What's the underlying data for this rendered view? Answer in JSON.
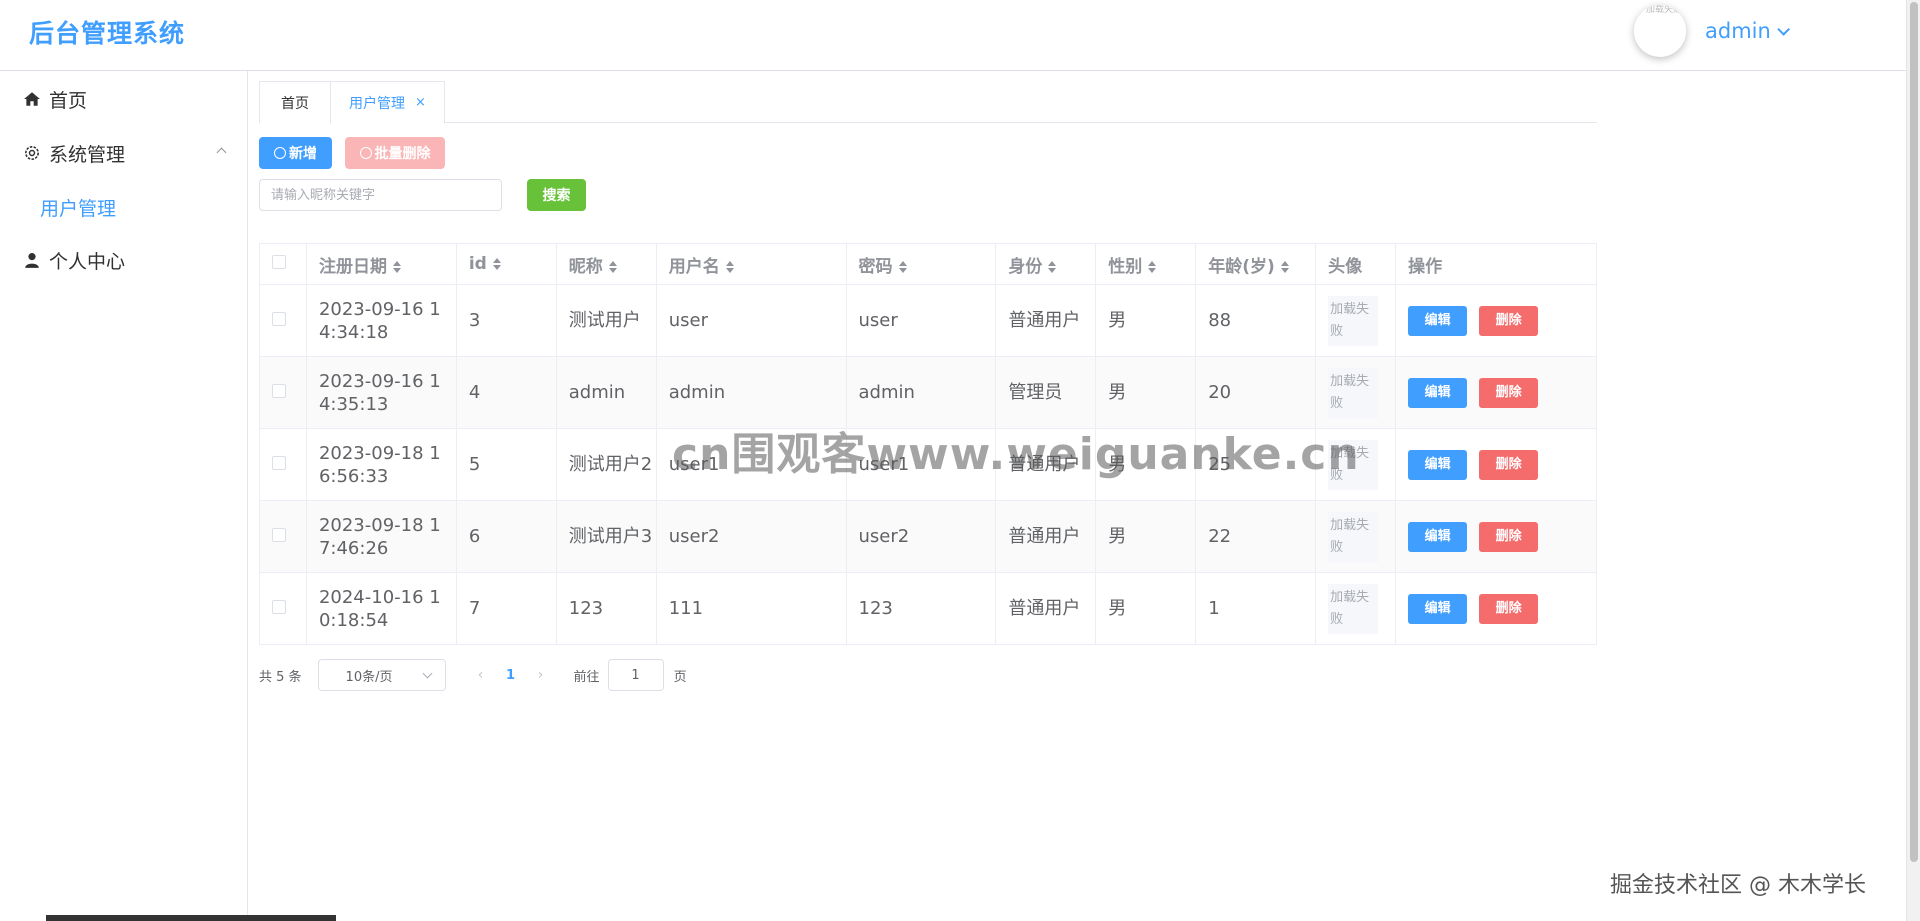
{
  "header": {
    "title": "后台管理系统",
    "avatar_text": "加载失败",
    "user_name": "admin"
  },
  "sidebar": {
    "items": [
      {
        "label": "首页",
        "icon": "home-icon"
      },
      {
        "label": "系统管理",
        "icon": "gear-icon",
        "expanded": true
      },
      {
        "label": "用户管理",
        "active": true
      },
      {
        "label": "个人中心",
        "icon": "user-icon"
      }
    ]
  },
  "tabs": [
    {
      "label": "首页"
    },
    {
      "label": "用户管理",
      "active": true,
      "close": "×"
    }
  ],
  "toolbar": {
    "add_label": "新增",
    "batch_delete_label": "批量删除",
    "search_placeholder": "请输入昵称关键字",
    "search_label": "搜索"
  },
  "table": {
    "columns": [
      "注册日期",
      "id",
      "昵称",
      "用户名",
      "密码",
      "身份",
      "性别",
      "年龄(岁)",
      "头像",
      "操作"
    ],
    "rows": [
      {
        "date": "2023-09-16 14:34:18",
        "id": "3",
        "nickname": "测试用户",
        "username": "user",
        "password": "user",
        "role": "普通用户",
        "gender": "男",
        "age": "88",
        "avatar": "加载失败"
      },
      {
        "date": "2023-09-16 14:35:13",
        "id": "4",
        "nickname": "admin",
        "username": "admin",
        "password": "admin",
        "role": "管理员",
        "gender": "男",
        "age": "20",
        "avatar": "加载失败"
      },
      {
        "date": "2023-09-18 16:56:33",
        "id": "5",
        "nickname": "测试用户2",
        "username": "user1",
        "password": "user1",
        "role": "普通用户",
        "gender": "男",
        "age": "25",
        "avatar": "加载失败"
      },
      {
        "date": "2023-09-18 17:46:26",
        "id": "6",
        "nickname": "测试用户3",
        "username": "user2",
        "password": "user2",
        "role": "普通用户",
        "gender": "男",
        "age": "22",
        "avatar": "加载失败"
      },
      {
        "date": "2024-10-16 10:18:54",
        "id": "7",
        "nickname": "123",
        "username": "111",
        "password": "123",
        "role": "普通用户",
        "gender": "男",
        "age": "1",
        "avatar": "加载失败"
      }
    ],
    "edit_label": "编辑",
    "delete_label": "删除"
  },
  "pagination": {
    "total": "共 5 条",
    "page_size": "10条/页",
    "prev": "‹",
    "current": "1",
    "next": "›",
    "goto_label": "前往",
    "goto_value": "1",
    "goto_unit": "页"
  },
  "watermarks": {
    "center": "cn围观客www.weiguanke.cn",
    "corner": "掘金技术社区 @ 木木学长"
  },
  "colors": {
    "primary": "#409eff",
    "success": "#67c23a",
    "danger": "#f56c6c",
    "danger_light": "#fab6b6"
  }
}
